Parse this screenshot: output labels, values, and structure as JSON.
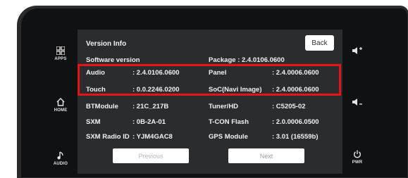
{
  "sidebar_left": [
    {
      "icon": "apps-grid-icon",
      "glyph": "☷",
      "label": "APPS"
    },
    {
      "icon": "home-icon",
      "glyph": "⌂",
      "label": "HOME"
    },
    {
      "icon": "music-note-icon",
      "glyph": "♪",
      "label": "AUDIO"
    }
  ],
  "sidebar_right": [
    {
      "icon": "volume-up-icon",
      "glyph": "◀+",
      "label": ""
    },
    {
      "icon": "volume-down-icon",
      "glyph": "◀-",
      "label": ""
    },
    {
      "icon": "power-icon",
      "glyph": "⏻",
      "label": "PWR"
    }
  ],
  "header": {
    "title": "Version Info",
    "back_label": "Back"
  },
  "software_version_label": "Software version",
  "package": "Package : 2.4.0106.0600",
  "rows": [
    {
      "left_key": "Audio",
      "left_val": ": 2.4.0106.0600",
      "right_key": "Panel",
      "right_val": ": 2.4.0006.0600"
    },
    {
      "left_key": "Touch",
      "left_val": ": 0.0.2246.0200",
      "right_key": "SoC(Navi Image)",
      "right_val": ": 2.4.0006.0600"
    },
    {
      "left_key": "BTModule",
      "left_val": ": 21C_217B",
      "right_key": "Tuner/HD",
      "right_val": ": C5205-02"
    },
    {
      "left_key": "SXM",
      "left_val": ": 0B-2A-01",
      "right_key": "T-CON Flash",
      "right_val": ": 2.0.0006.0500"
    },
    {
      "left_key": "SXM Radio ID",
      "left_val": ": YJM4GAC8",
      "right_key": "GPS Module",
      "right_val": ": 3.01 (16559b)"
    }
  ],
  "footer": {
    "previous_label": "Previous",
    "next_label": "Next"
  },
  "colors": {
    "highlight": "#e51417",
    "screen": "#2b2c2e"
  }
}
